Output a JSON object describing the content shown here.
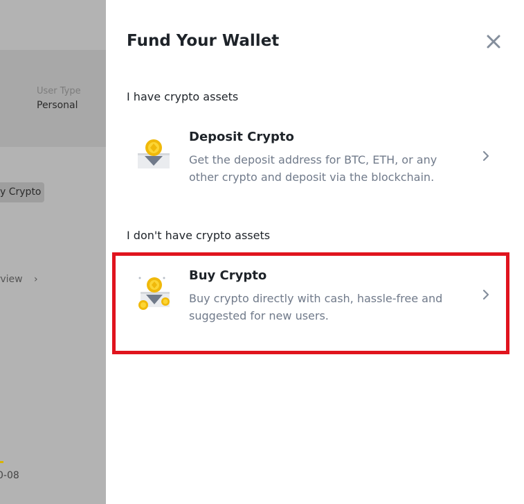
{
  "background": {
    "user_type_label": "User Type",
    "user_type_value": "Personal",
    "buy_crypto_button": "y Crypto",
    "overview_link": "erview",
    "date_fragment": "0-08"
  },
  "drawer": {
    "title": "Fund Your Wallet",
    "close_icon": "close-icon",
    "sections": [
      {
        "label": "I have crypto assets",
        "option": {
          "title": "Deposit Crypto",
          "description": "Get the deposit address for BTC, ETH, or any other crypto and deposit via the blockchain.",
          "icon": "deposit-coin-icon"
        }
      },
      {
        "label": "I don't have crypto assets",
        "option": {
          "title": "Buy Crypto",
          "description": "Buy crypto directly with cash, hassle-free and suggested for new users.",
          "icon": "buy-coins-icon"
        }
      }
    ]
  },
  "colors": {
    "highlight_border": "#e0141e",
    "coin_gold": "#f0b90b",
    "text_primary": "#1e2329",
    "text_secondary": "#707a8a",
    "overlay_gray": "#b3b3b3"
  }
}
